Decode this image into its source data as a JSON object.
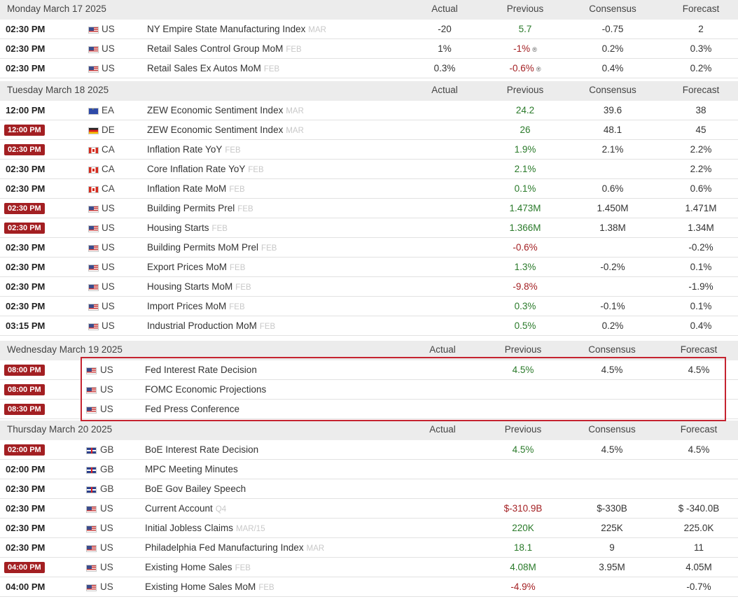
{
  "columns": {
    "actual": "Actual",
    "previous": "Previous",
    "consensus": "Consensus",
    "forecast": "Forecast"
  },
  "days": [
    {
      "label": "Monday March 17 2025",
      "rows": [
        {
          "time": "02:30 PM",
          "badge": false,
          "flag": "us",
          "country": "US",
          "event": "NY Empire State Manufacturing Index",
          "ref": "MAR",
          "actual": "-20",
          "previous": "5.7",
          "previous_color": "green",
          "revised": false,
          "consensus": "-0.75",
          "forecast": "2"
        },
        {
          "time": "02:30 PM",
          "badge": false,
          "flag": "us",
          "country": "US",
          "event": "Retail Sales Control Group MoM",
          "ref": "FEB",
          "actual": "1%",
          "previous": "-1%",
          "previous_color": "red",
          "revised": true,
          "consensus": "0.2%",
          "forecast": "0.3%"
        },
        {
          "time": "02:30 PM",
          "badge": false,
          "flag": "us",
          "country": "US",
          "event": "Retail Sales Ex Autos MoM",
          "ref": "FEB",
          "actual": "0.3%",
          "previous": "-0.6%",
          "previous_color": "red",
          "revised": true,
          "consensus": "0.4%",
          "forecast": "0.2%"
        }
      ]
    },
    {
      "label": "Tuesday March 18 2025",
      "rows": [
        {
          "time": "12:00 PM",
          "badge": false,
          "flag": "ea",
          "country": "EA",
          "event": "ZEW Economic Sentiment Index",
          "ref": "MAR",
          "actual": "",
          "previous": "24.2",
          "previous_color": "green",
          "revised": false,
          "consensus": "39.6",
          "forecast": "38"
        },
        {
          "time": "12:00 PM",
          "badge": true,
          "flag": "de",
          "country": "DE",
          "event": "ZEW Economic Sentiment Index",
          "ref": "MAR",
          "actual": "",
          "previous": "26",
          "previous_color": "green",
          "revised": false,
          "consensus": "48.1",
          "forecast": "45"
        },
        {
          "time": "02:30 PM",
          "badge": true,
          "flag": "ca",
          "country": "CA",
          "event": "Inflation Rate YoY",
          "ref": "FEB",
          "actual": "",
          "previous": "1.9%",
          "previous_color": "green",
          "revised": false,
          "consensus": "2.1%",
          "forecast": "2.2%"
        },
        {
          "time": "02:30 PM",
          "badge": false,
          "flag": "ca",
          "country": "CA",
          "event": "Core Inflation Rate YoY",
          "ref": "FEB",
          "actual": "",
          "previous": "2.1%",
          "previous_color": "green",
          "revised": false,
          "consensus": "",
          "forecast": "2.2%"
        },
        {
          "time": "02:30 PM",
          "badge": false,
          "flag": "ca",
          "country": "CA",
          "event": "Inflation Rate MoM",
          "ref": "FEB",
          "actual": "",
          "previous": "0.1%",
          "previous_color": "green",
          "revised": false,
          "consensus": "0.6%",
          "forecast": "0.6%"
        },
        {
          "time": "02:30 PM",
          "badge": true,
          "flag": "us",
          "country": "US",
          "event": "Building Permits Prel",
          "ref": "FEB",
          "actual": "",
          "previous": "1.473M",
          "previous_color": "green",
          "revised": false,
          "consensus": "1.450M",
          "forecast": "1.471M"
        },
        {
          "time": "02:30 PM",
          "badge": true,
          "flag": "us",
          "country": "US",
          "event": "Housing Starts",
          "ref": "FEB",
          "actual": "",
          "previous": "1.366M",
          "previous_color": "green",
          "revised": false,
          "consensus": "1.38M",
          "forecast": "1.34M"
        },
        {
          "time": "02:30 PM",
          "badge": false,
          "flag": "us",
          "country": "US",
          "event": "Building Permits MoM Prel",
          "ref": "FEB",
          "actual": "",
          "previous": "-0.6%",
          "previous_color": "red",
          "revised": false,
          "consensus": "",
          "forecast": "-0.2%"
        },
        {
          "time": "02:30 PM",
          "badge": false,
          "flag": "us",
          "country": "US",
          "event": "Export Prices MoM",
          "ref": "FEB",
          "actual": "",
          "previous": "1.3%",
          "previous_color": "green",
          "revised": false,
          "consensus": "-0.2%",
          "forecast": "0.1%"
        },
        {
          "time": "02:30 PM",
          "badge": false,
          "flag": "us",
          "country": "US",
          "event": "Housing Starts MoM",
          "ref": "FEB",
          "actual": "",
          "previous": "-9.8%",
          "previous_color": "red",
          "revised": false,
          "consensus": "",
          "forecast": "-1.9%"
        },
        {
          "time": "02:30 PM",
          "badge": false,
          "flag": "us",
          "country": "US",
          "event": "Import Prices MoM",
          "ref": "FEB",
          "actual": "",
          "previous": "0.3%",
          "previous_color": "green",
          "revised": false,
          "consensus": "-0.1%",
          "forecast": "0.1%"
        },
        {
          "time": "03:15 PM",
          "badge": false,
          "flag": "us",
          "country": "US",
          "event": "Industrial Production MoM",
          "ref": "FEB",
          "actual": "",
          "previous": "0.5%",
          "previous_color": "green",
          "revised": false,
          "consensus": "0.2%",
          "forecast": "0.4%"
        }
      ]
    },
    {
      "label": "Wednesday March 19 2025",
      "rows": [
        {
          "time": "08:00 PM",
          "badge": true,
          "flag": "us",
          "country": "US",
          "event": "Fed Interest Rate Decision",
          "ref": "",
          "actual": "",
          "previous": "4.5%",
          "previous_color": "green",
          "revised": false,
          "consensus": "4.5%",
          "forecast": "4.5%"
        },
        {
          "time": "08:00 PM",
          "badge": true,
          "flag": "us",
          "country": "US",
          "event": "FOMC Economic Projections",
          "ref": "",
          "actual": "",
          "previous": "",
          "previous_color": "green",
          "revised": false,
          "consensus": "",
          "forecast": ""
        },
        {
          "time": "08:30 PM",
          "badge": true,
          "flag": "us",
          "country": "US",
          "event": "Fed Press Conference",
          "ref": "",
          "actual": "",
          "previous": "",
          "previous_color": "green",
          "revised": false,
          "consensus": "",
          "forecast": ""
        }
      ]
    },
    {
      "label": "Thursday March 20 2025",
      "rows": [
        {
          "time": "02:00 PM",
          "badge": true,
          "flag": "gb",
          "country": "GB",
          "event": "BoE Interest Rate Decision",
          "ref": "",
          "actual": "",
          "previous": "4.5%",
          "previous_color": "green",
          "revised": false,
          "consensus": "4.5%",
          "forecast": "4.5%"
        },
        {
          "time": "02:00 PM",
          "badge": false,
          "flag": "gb",
          "country": "GB",
          "event": "MPC Meeting Minutes",
          "ref": "",
          "actual": "",
          "previous": "",
          "previous_color": "green",
          "revised": false,
          "consensus": "",
          "forecast": ""
        },
        {
          "time": "02:30 PM",
          "badge": false,
          "flag": "gb",
          "country": "GB",
          "event": "BoE Gov Bailey Speech",
          "ref": "",
          "actual": "",
          "previous": "",
          "previous_color": "green",
          "revised": false,
          "consensus": "",
          "forecast": ""
        },
        {
          "time": "02:30 PM",
          "badge": false,
          "flag": "us",
          "country": "US",
          "event": "Current Account",
          "ref": "Q4",
          "actual": "",
          "previous": "$-310.9B",
          "previous_color": "red",
          "revised": false,
          "consensus": "$-330B",
          "forecast": "$ -340.0B"
        },
        {
          "time": "02:30 PM",
          "badge": false,
          "flag": "us",
          "country": "US",
          "event": "Initial Jobless Claims",
          "ref": "MAR/15",
          "actual": "",
          "previous": "220K",
          "previous_color": "green",
          "revised": false,
          "consensus": "225K",
          "forecast": "225.0K"
        },
        {
          "time": "02:30 PM",
          "badge": false,
          "flag": "us",
          "country": "US",
          "event": "Philadelphia Fed Manufacturing Index",
          "ref": "MAR",
          "actual": "",
          "previous": "18.1",
          "previous_color": "green",
          "revised": false,
          "consensus": "9",
          "forecast": "11"
        },
        {
          "time": "04:00 PM",
          "badge": true,
          "flag": "us",
          "country": "US",
          "event": "Existing Home Sales",
          "ref": "FEB",
          "actual": "",
          "previous": "4.08M",
          "previous_color": "green",
          "revised": false,
          "consensus": "3.95M",
          "forecast": "4.05M"
        },
        {
          "time": "04:00 PM",
          "badge": false,
          "flag": "us",
          "country": "US",
          "event": "Existing Home Sales MoM",
          "ref": "FEB",
          "actual": "",
          "previous": "-4.9%",
          "previous_color": "red",
          "revised": false,
          "consensus": "",
          "forecast": "-0.7%"
        }
      ]
    }
  ],
  "revised_marker": "®",
  "highlight_color": "#c52330",
  "badge_color": "#a31f22"
}
